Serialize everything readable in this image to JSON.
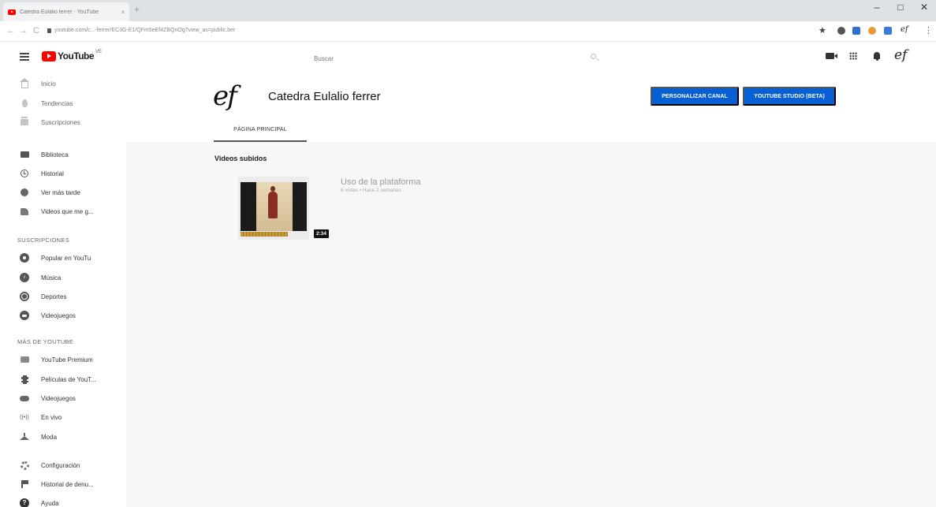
{
  "browser": {
    "tab_title": "Catedra Eulalio ferrer - YouTube",
    "tab_close": "×",
    "new_tab": "+",
    "url": "youtube.com/c...-ferrer/EC3G-E1/QFm5eEf4ZBQnOg?view_as=public.ber",
    "win_min": "–",
    "win_max": "□",
    "win_close": "✕"
  },
  "masthead": {
    "logo_text": "YouTube",
    "logo_country": "VE",
    "search_placeholder": "Buscar",
    "avatar_text": "ef"
  },
  "sidebar": {
    "main": [
      {
        "label": "Inicio",
        "icon": "home-icon"
      },
      {
        "label": "Tendencias",
        "icon": "trending-icon"
      },
      {
        "label": "Suscripciones",
        "icon": "subscriptions-icon"
      }
    ],
    "library": [
      {
        "label": "Biblioteca",
        "icon": "library-icon"
      },
      {
        "label": "Historial",
        "icon": "history-icon"
      },
      {
        "label": "Ver más tarde",
        "icon": "watch-later-icon"
      },
      {
        "label": "Videos que me g...",
        "icon": "liked-icon"
      }
    ],
    "subscriptions_heading": "SUSCRIPCIONES",
    "subscriptions": [
      {
        "label": "Popular en YouTu",
        "icon": "popular-icon"
      },
      {
        "label": "Música",
        "icon": "music-icon",
        "glyph": "♪"
      },
      {
        "label": "Deportes",
        "icon": "sports-icon"
      },
      {
        "label": "Videojuegos",
        "icon": "gaming-icon"
      }
    ],
    "more_heading": "MÁS DE YOUTUBE",
    "more": [
      {
        "label": "YouTube Premium",
        "icon": "youtube-premium-icon"
      },
      {
        "label": "Películas de YouT...",
        "icon": "movies-icon"
      },
      {
        "label": "Videojuegos",
        "icon": "gamepad-icon"
      },
      {
        "label": "En vivo",
        "icon": "live-icon",
        "glyph": "((•))"
      },
      {
        "label": "Moda",
        "icon": "hanger-icon"
      }
    ],
    "settings": [
      {
        "label": "Configuración",
        "icon": "settings-icon"
      },
      {
        "label": "Historial de denu...",
        "icon": "flag-icon"
      },
      {
        "label": "Ayuda",
        "icon": "help-icon",
        "glyph": "?"
      }
    ]
  },
  "channel": {
    "avatar_text": "ef",
    "name": "Catedra Eulalio ferrer",
    "customize_button": "PERSONALIZAR CANAL",
    "studio_button": "YOUTUBE STUDIO (BETA)",
    "tab_home": "PÁGINA PRINCIPAL",
    "section_title": "Videos subidos",
    "videos": [
      {
        "title": "Uso de la plataforma",
        "meta": "6 vistas • Hace 2 semanas",
        "duration": "2:34"
      }
    ]
  },
  "colors": {
    "accent_blue": "#065fd4",
    "youtube_red": "#ff0000"
  }
}
